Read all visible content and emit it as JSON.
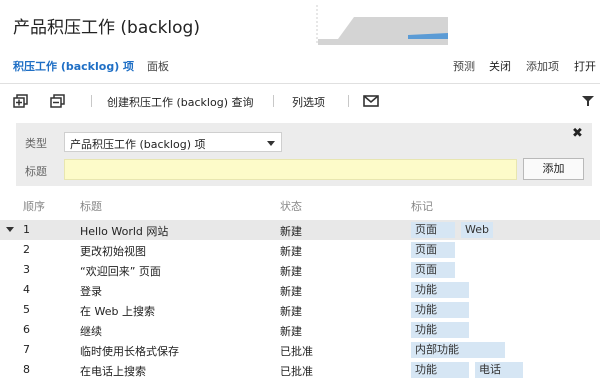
{
  "page": {
    "title": "产品积压工作 (backlog)"
  },
  "tabs": {
    "backlog_items": "积压工作 (backlog) 项",
    "board": "面板"
  },
  "right_links": {
    "forecast": "预测",
    "close": "关闭",
    "add_item": "添加项",
    "open": "打开"
  },
  "toolbar": {
    "create_query": "创建积压工作 (backlog) 查询",
    "column_options": "列选项"
  },
  "add_panel": {
    "type_label": "类型",
    "type_value": "产品积压工作 (backlog) 项",
    "title_label": "标题",
    "title_value": "",
    "add_button": "添加"
  },
  "columns": {
    "order": "顺序",
    "title": "标题",
    "state": "状态",
    "tags": "标记"
  },
  "rows": [
    {
      "order": "1",
      "title": "Hello World 网站",
      "state": "新建",
      "tags": [
        "页面",
        "Web"
      ]
    },
    {
      "order": "2",
      "title": "更改初始视图",
      "state": "新建",
      "tags": [
        "页面"
      ]
    },
    {
      "order": "3",
      "title": "“欢迎回来” 页面",
      "state": "新建",
      "tags": [
        "页面"
      ]
    },
    {
      "order": "4",
      "title": "登录",
      "state": "新建",
      "tags": [
        "功能"
      ]
    },
    {
      "order": "5",
      "title": "在 Web 上搜索",
      "state": "新建",
      "tags": [
        "功能"
      ]
    },
    {
      "order": "6",
      "title": "继续",
      "state": "新建",
      "tags": [
        "功能"
      ]
    },
    {
      "order": "7",
      "title": "临时使用长格式保存",
      "state": "已批准",
      "tags": [
        "内部功能"
      ]
    },
    {
      "order": "8",
      "title": "在电话上搜索",
      "state": "已批准",
      "tags": [
        "功能",
        "电话"
      ]
    }
  ],
  "icons": {
    "expand_all": "expand-all-icon",
    "collapse_all": "collapse-all-icon",
    "email": "email-icon",
    "filter": "filter-icon",
    "close": "close-icon"
  },
  "colors": {
    "accent": "#1f6fc5",
    "tag_bg": "#d6e6f4",
    "title_input_bg": "#fdfbc9",
    "selected_row_bg": "#e8e8e8",
    "panel_bg": "#ececec",
    "chart_gray": "#d4d4d4",
    "chart_blue": "#5b9bd5"
  }
}
